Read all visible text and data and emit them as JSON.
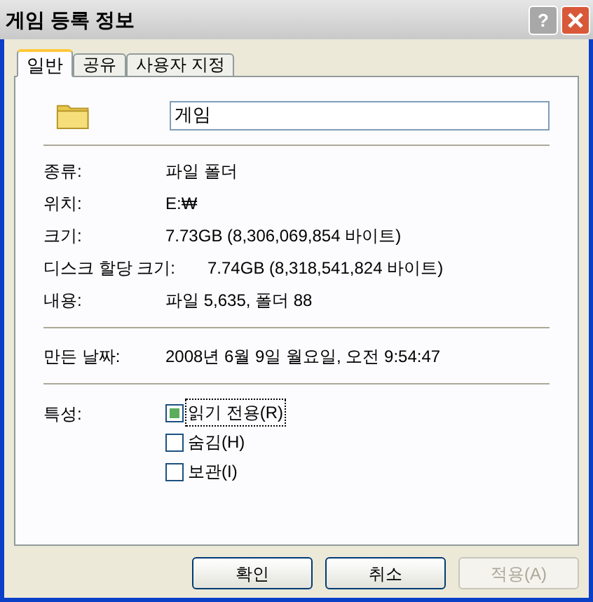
{
  "window": {
    "title": "게임 등록 정보"
  },
  "title_buttons": [
    {
      "kind": "help",
      "label": "?"
    },
    {
      "kind": "close"
    }
  ],
  "tabs": [
    {
      "label": "일반",
      "selected": true
    },
    {
      "label": "공유",
      "selected": false
    },
    {
      "label": "사용자 지정",
      "selected": false
    }
  ],
  "name_field": {
    "value": "게임"
  },
  "properties": [
    {
      "label": "종류:",
      "value": "파일 폴더"
    },
    {
      "label": "위치:",
      "value": "E:₩"
    },
    {
      "label": "크기:",
      "value": "7.73GB (8,306,069,854 바이트)"
    },
    {
      "label": "디스크 할당 크기:",
      "value": "7.74GB (8,318,541,824 바이트)",
      "wide": true
    },
    {
      "label": "내용:",
      "value": "파일 5,635, 폴더 88"
    }
  ],
  "created": {
    "label": "만든 날짜:",
    "value": "2008년 6월 9일 월요일, 오전 9:54:47"
  },
  "attributes": {
    "label": "특성:",
    "items": [
      {
        "label": "읽기 전용(R)",
        "checked": true,
        "focused": true
      },
      {
        "label": "숨김(H)",
        "checked": false,
        "focused": false
      },
      {
        "label": "보관(I)",
        "checked": false,
        "focused": false
      }
    ]
  },
  "buttons": [
    {
      "label": "확인",
      "disabled": false
    },
    {
      "label": "취소",
      "disabled": false
    },
    {
      "label": "적용(A)",
      "disabled": true
    }
  ]
}
